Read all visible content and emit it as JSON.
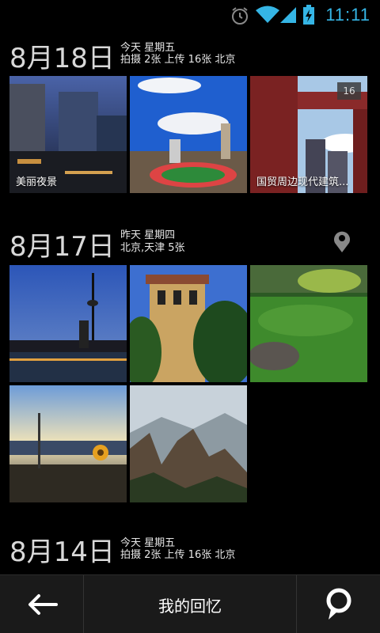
{
  "status_bar": {
    "time": "11:11",
    "icons": [
      "alarm-icon",
      "wifi-icon",
      "signal-icon",
      "battery-charging-icon"
    ],
    "accent_color": "#35b5e5"
  },
  "sections": [
    {
      "date": "8月18日",
      "line1": "今天 星期五",
      "line2": "拍摄 2张 上传 16张 北京",
      "photos": [
        {
          "caption": "美丽夜景"
        },
        {
          "caption": ""
        },
        {
          "caption": "国贸周边现代建筑...",
          "badge": "16"
        }
      ]
    },
    {
      "date": "8月17日",
      "line1": "昨天 星期四",
      "line2": "北京,天津 5张",
      "has_location_icon": true,
      "photos": [
        {
          "caption": ""
        },
        {
          "caption": ""
        },
        {
          "caption": ""
        },
        {
          "caption": ""
        },
        {
          "caption": ""
        }
      ]
    },
    {
      "date": "8月14日",
      "line1": "今天 星期五",
      "line2": "拍摄 2张 上传 16张 北京"
    }
  ],
  "bottom_bar": {
    "title": "我的回忆",
    "back_icon": "back-arrow-icon",
    "action_icon": "location-pin-icon"
  }
}
